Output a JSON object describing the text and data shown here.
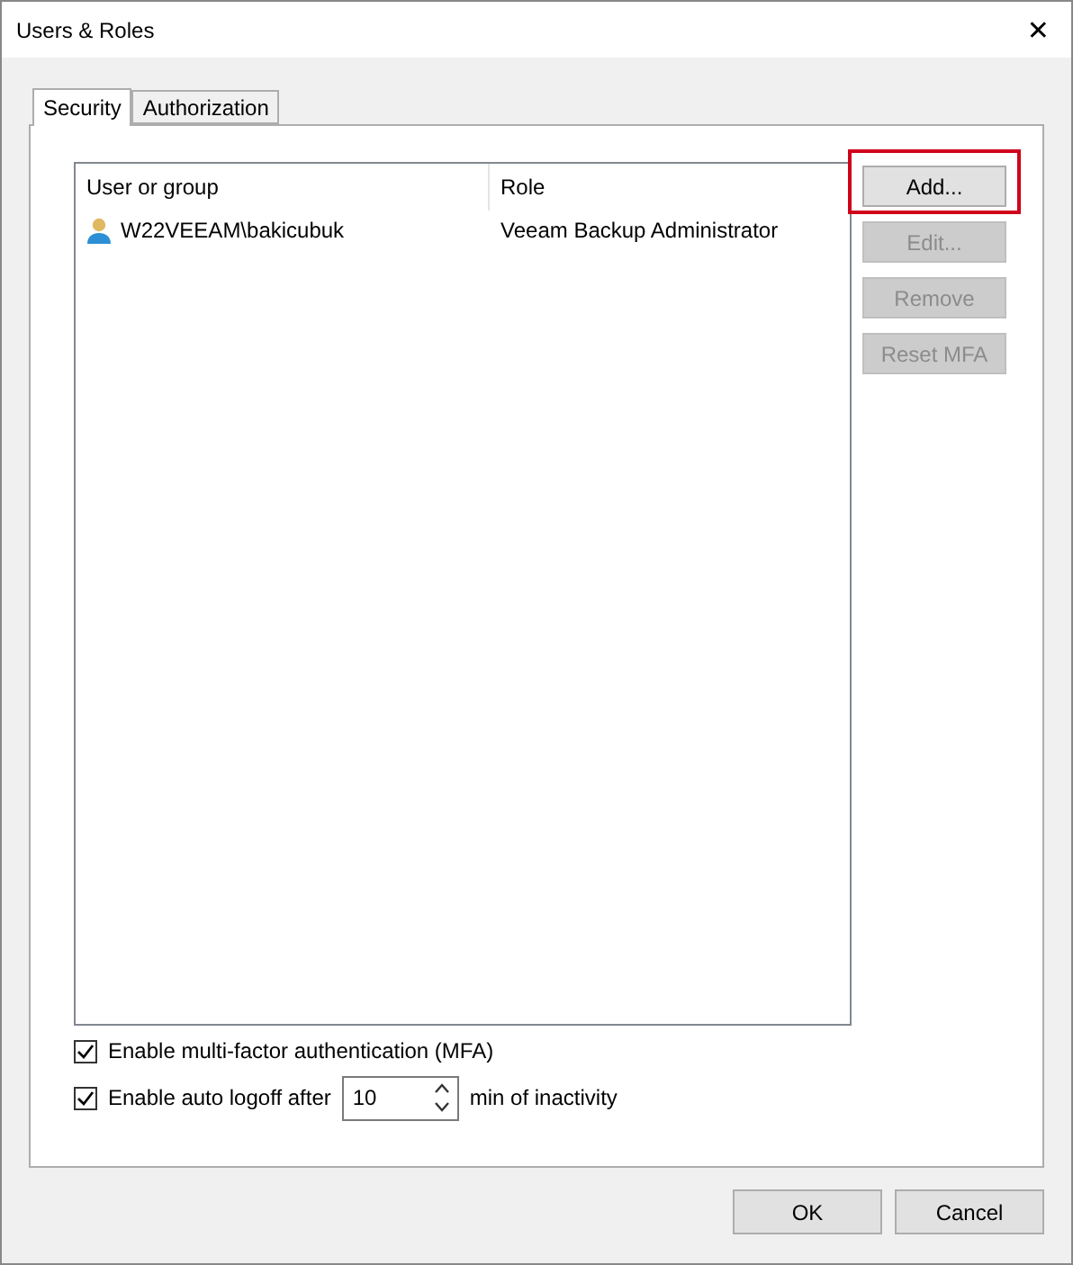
{
  "window": {
    "title": "Users & Roles",
    "close": "✕"
  },
  "tabs": [
    {
      "label": "Security",
      "selected": true
    },
    {
      "label": "Authorization",
      "selected": false
    }
  ],
  "table": {
    "columns": [
      "User or group",
      "Role"
    ],
    "rows": [
      {
        "user": "W22VEEAM\\bakicubuk",
        "role": "Veeam Backup Administrator",
        "selected": false
      }
    ]
  },
  "side_buttons": [
    {
      "label": "Add...",
      "disabled": false,
      "highlighted": true
    },
    {
      "label": "Edit...",
      "disabled": true,
      "highlighted": false
    },
    {
      "label": "Remove",
      "disabled": true,
      "highlighted": false
    },
    {
      "label": "Reset MFA",
      "disabled": true,
      "highlighted": false
    }
  ],
  "mfa": {
    "label": "Enable multi-factor authentication (MFA)",
    "checked": true
  },
  "auto_logoff": {
    "label": "Enable auto logoff after",
    "checked": true,
    "value": "10",
    "suffix": "min of inactivity"
  },
  "buttons": [
    "OK",
    "Cancel"
  ]
}
